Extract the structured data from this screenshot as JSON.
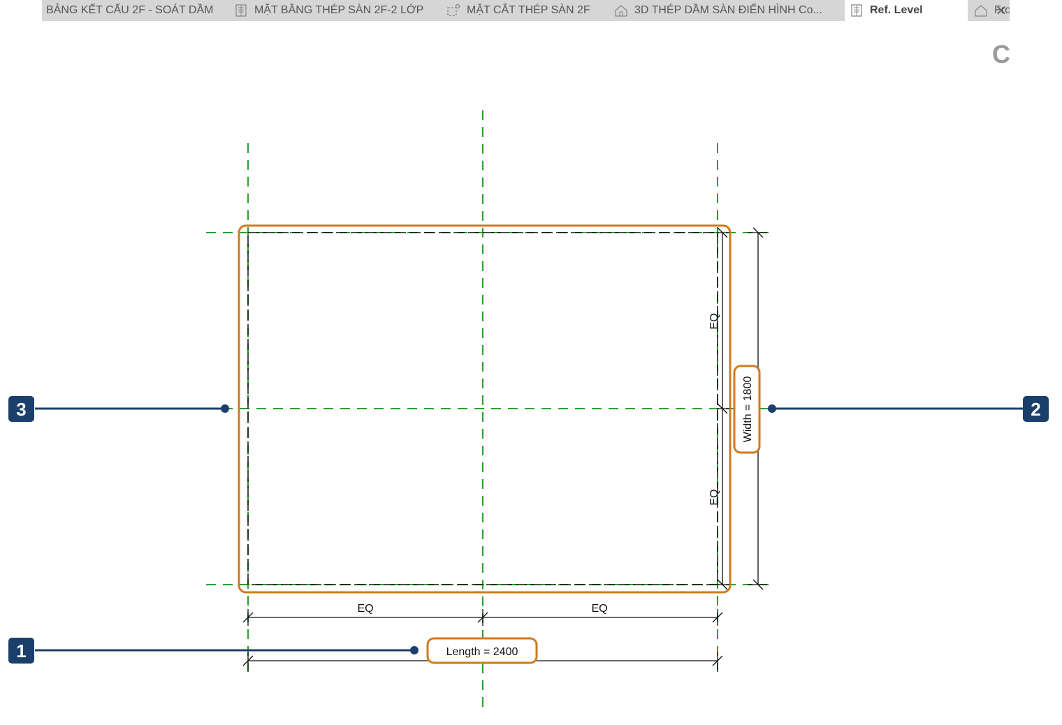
{
  "tabs": [
    {
      "label": "BẢNG KẾT CẤU 2F - SOÁT DẦM",
      "icon": "none",
      "active": false
    },
    {
      "label": "MẶT BẰNG THÉP SÀN 2F-2 LỚP",
      "icon": "floor-plan-icon",
      "active": false
    },
    {
      "label": "MẶT CẮT THÉP SÀN 2F",
      "icon": "section-icon",
      "active": false
    },
    {
      "label": "3D THÉP DẦM SÀN ĐIỂN HÌNH Co...",
      "icon": "3d-house-icon",
      "active": false
    },
    {
      "label": "Ref. Level",
      "icon": "floor-plan-icon",
      "active": true
    },
    {
      "label": "Fro",
      "icon": "elevation-house-icon",
      "active": false
    }
  ],
  "close_glyph": "✕",
  "corner_glyph": "C",
  "drawing": {
    "eq_label": "EQ",
    "length_label": "Length = 2400",
    "width_label": "Width = 1800"
  },
  "callouts": [
    {
      "number": "1"
    },
    {
      "number": "2"
    },
    {
      "number": "3"
    }
  ],
  "colors": {
    "highlight": "#d07a1e",
    "callout": "#1b3f6b",
    "ref_plane": "#2e9e2e",
    "line": "#111111"
  }
}
